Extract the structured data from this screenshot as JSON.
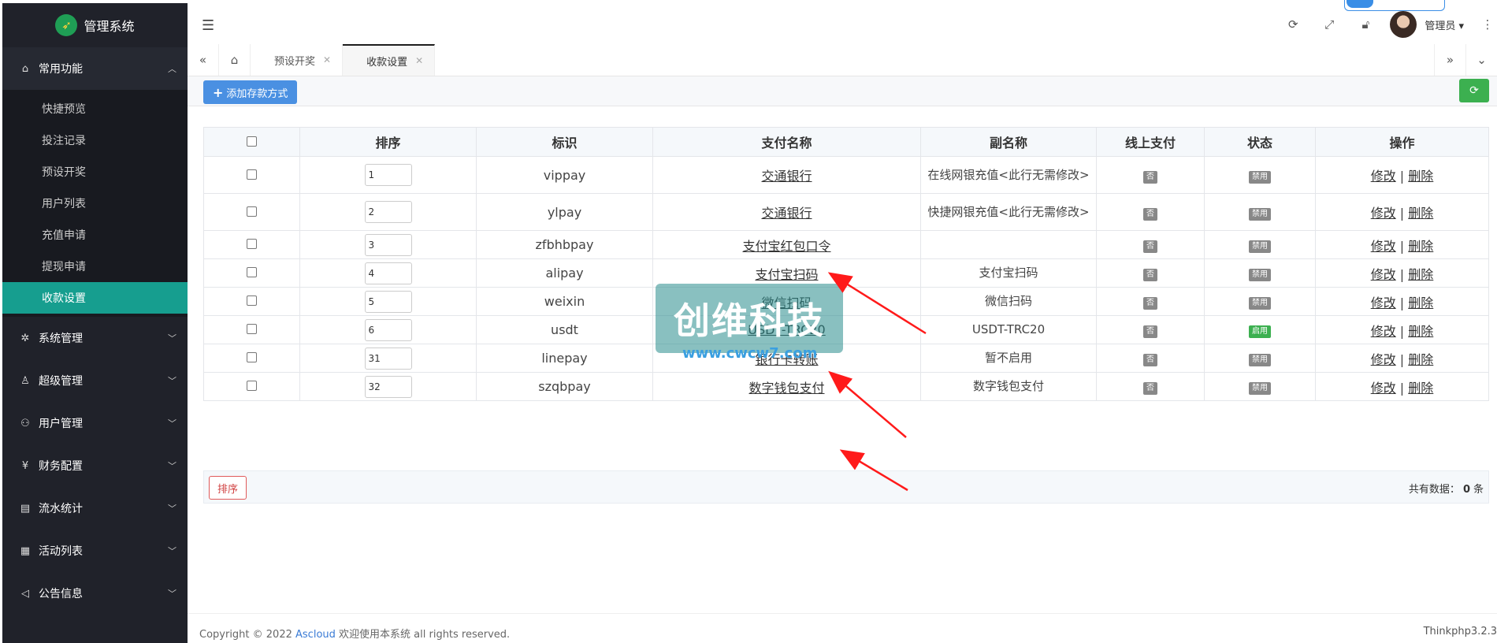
{
  "app": {
    "title": "管理系统"
  },
  "sidebar": {
    "groups": [
      {
        "label": "常用功能",
        "icon": "home-icon",
        "open": true,
        "items": [
          {
            "label": "快捷预览"
          },
          {
            "label": "投注记录"
          },
          {
            "label": "预设开奖"
          },
          {
            "label": "用户列表"
          },
          {
            "label": "充值申请"
          },
          {
            "label": "提现申请"
          },
          {
            "label": "收款设置",
            "active": true
          }
        ]
      },
      {
        "label": "系统管理",
        "icon": "gear-icon"
      },
      {
        "label": "超级管理",
        "icon": "user-icon"
      },
      {
        "label": "用户管理",
        "icon": "users-icon"
      },
      {
        "label": "财务配置",
        "icon": "yen-icon"
      },
      {
        "label": "流水统计",
        "icon": "clipboard-icon"
      },
      {
        "label": "活动列表",
        "icon": "gift-icon"
      },
      {
        "label": "公告信息",
        "icon": "speaker-icon"
      }
    ]
  },
  "header": {
    "admin_name": "管理员"
  },
  "tabs": [
    {
      "label": "预设开奖",
      "active": false
    },
    {
      "label": "收款设置",
      "active": true
    }
  ],
  "toolbar": {
    "add_label": "添加存款方式"
  },
  "table": {
    "headers": [
      "排序",
      "标识",
      "支付名称",
      "副名称",
      "线上支付",
      "状态",
      "操作"
    ],
    "rows": [
      {
        "order": "1",
        "code": "vippay",
        "name": "交通银行",
        "subname": "在线网银充值<此行无需修改>",
        "online": "否",
        "status": "禁用",
        "enabled": false
      },
      {
        "order": "2",
        "code": "ylpay",
        "name": "交通银行",
        "subname": "快捷网银充值<此行无需修改>",
        "online": "否",
        "status": "禁用",
        "enabled": false
      },
      {
        "order": "3",
        "code": "zfbhbpay",
        "name": "支付宝红包口令",
        "subname": "",
        "online": "否",
        "status": "禁用",
        "enabled": false
      },
      {
        "order": "4",
        "code": "alipay",
        "name": "支付宝扫码",
        "subname": "支付宝扫码",
        "online": "否",
        "status": "禁用",
        "enabled": false
      },
      {
        "order": "5",
        "code": "weixin",
        "name": "微信扫码",
        "subname": "微信扫码",
        "online": "否",
        "status": "禁用",
        "enabled": false
      },
      {
        "order": "6",
        "code": "usdt",
        "name": "USDT-TRC20",
        "subname": "USDT-TRC20",
        "online": "否",
        "status": "启用",
        "enabled": true
      },
      {
        "order": "31",
        "code": "linepay",
        "name": "银行卡转账",
        "subname": "暂不启用",
        "online": "否",
        "status": "禁用",
        "enabled": false
      },
      {
        "order": "32",
        "code": "szqbpay",
        "name": "数字钱包支付",
        "subname": "数字钱包支付",
        "online": "否",
        "status": "禁用",
        "enabled": false
      }
    ],
    "edit_label": "修改",
    "separator": "|",
    "delete_label": "删除"
  },
  "bottom": {
    "sort_label": "排序",
    "total_prefix": "共有数据：",
    "total_count": "0",
    "total_suffix": "条"
  },
  "footer": {
    "copyright": "Copyright © 2022",
    "company": "Ascloud",
    "rest": "欢迎使用本系统 all rights reserved.",
    "version": "Thinkphp3.2.3"
  },
  "watermark": {
    "text": "创维科技",
    "url": "www.cwcw7.com"
  }
}
